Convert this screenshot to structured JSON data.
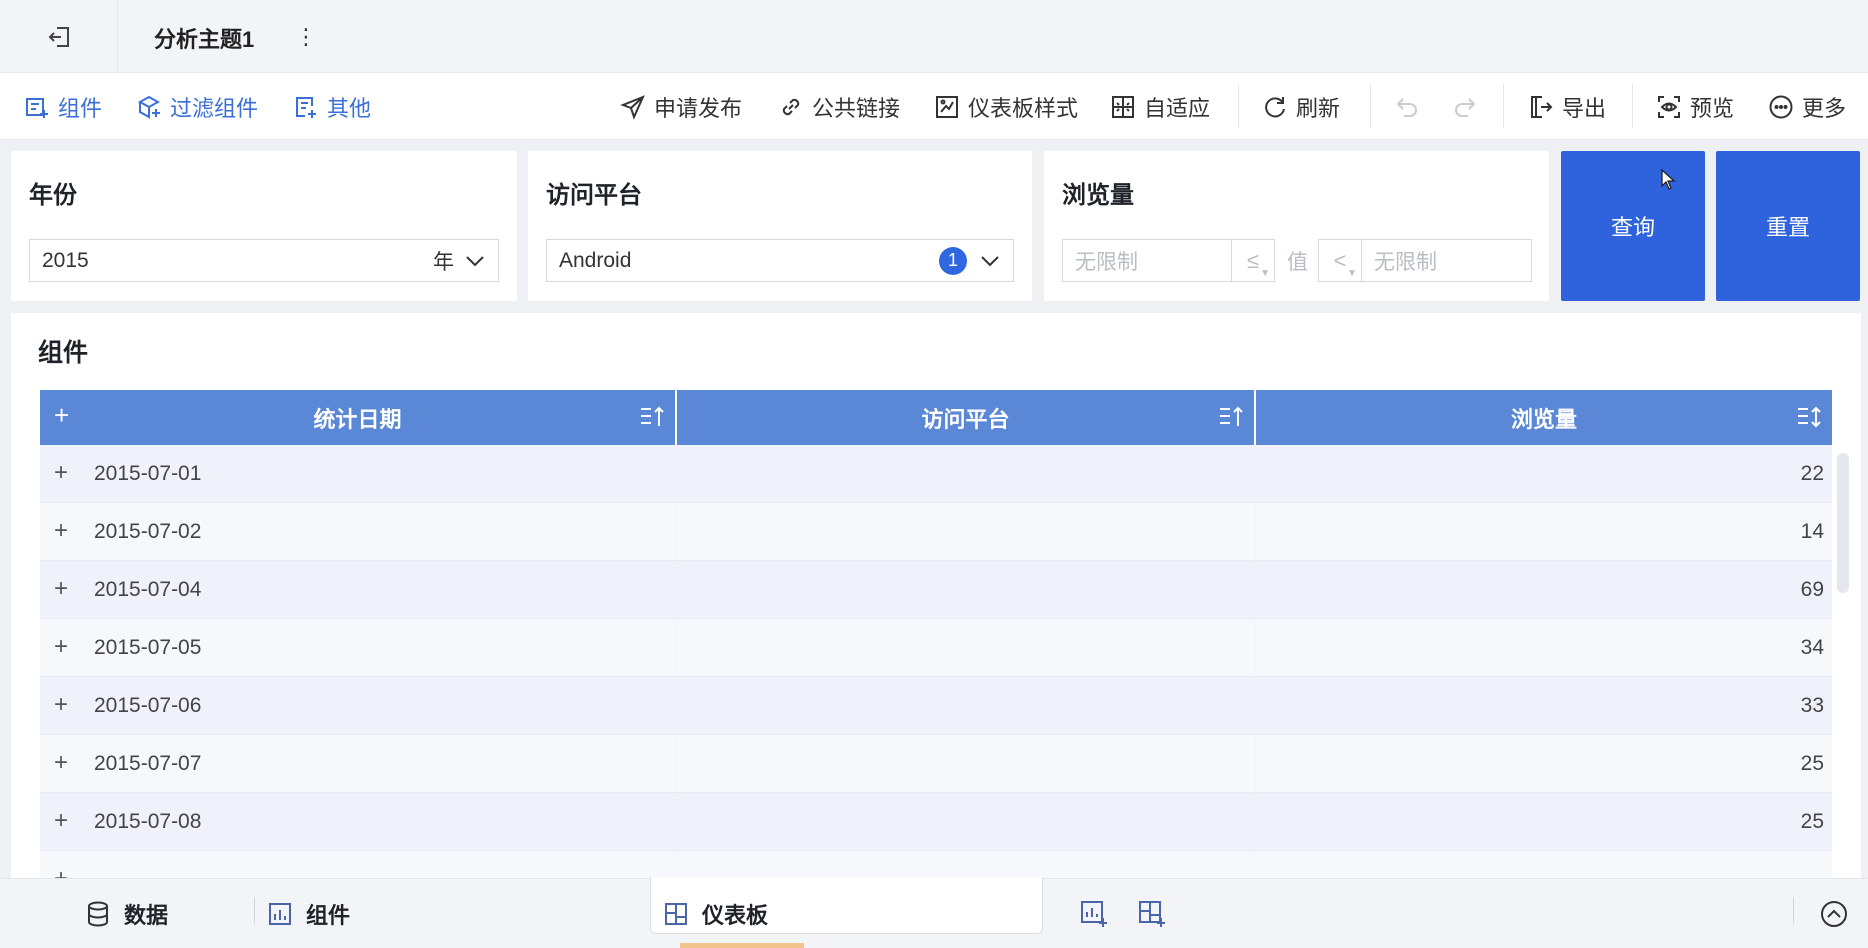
{
  "titlebar": {
    "title": "分析主题1",
    "more_glyph": "⋮"
  },
  "toolbar": {
    "left": [
      {
        "label": "组件",
        "icon": "component-add-icon"
      },
      {
        "label": "过滤组件",
        "icon": "filter-component-icon"
      },
      {
        "label": "其他",
        "icon": "other-add-icon"
      }
    ],
    "right": [
      {
        "label": "申请发布",
        "icon": "send-icon"
      },
      {
        "label": "公共链接",
        "icon": "link-icon"
      },
      {
        "label": "仪表板样式",
        "icon": "style-icon"
      },
      {
        "label": "自适应",
        "icon": "adaptive-icon"
      },
      {
        "label": "刷新",
        "icon": "refresh-icon"
      },
      {
        "label": "导出",
        "icon": "export-icon"
      },
      {
        "label": "预览",
        "icon": "preview-icon"
      },
      {
        "label": "更多",
        "icon": "more-circle-icon"
      }
    ]
  },
  "filters": {
    "year": {
      "title": "年份",
      "value": "2015",
      "suffix": "年"
    },
    "platform": {
      "title": "访问平台",
      "value": "Android",
      "badge": "1"
    },
    "views": {
      "title": "浏览量",
      "min_placeholder": "无限制",
      "op1": "≤",
      "value_label": "值",
      "op2": "<",
      "max_placeholder": "无限制"
    },
    "query_label": "查询",
    "reset_label": "重置"
  },
  "component": {
    "title": "组件",
    "table": {
      "columns": [
        "统计日期",
        "访问平台",
        "浏览量"
      ],
      "rows": [
        {
          "date": "2015-07-01",
          "platform": "",
          "views": "22"
        },
        {
          "date": "2015-07-02",
          "platform": "",
          "views": "14"
        },
        {
          "date": "2015-07-04",
          "platform": "",
          "views": "69"
        },
        {
          "date": "2015-07-05",
          "platform": "",
          "views": "34"
        },
        {
          "date": "2015-07-06",
          "platform": "",
          "views": "33"
        },
        {
          "date": "2015-07-07",
          "platform": "",
          "views": "25"
        },
        {
          "date": "2015-07-08",
          "platform": "",
          "views": "25"
        }
      ]
    }
  },
  "bottombar": {
    "data_label": "数据",
    "component_label": "组件",
    "dashboard_label": "仪表板"
  },
  "colors": {
    "accent": "#2f62dd",
    "table_header": "#5b88d6",
    "toolbar_blue": "#3a6fd8"
  }
}
